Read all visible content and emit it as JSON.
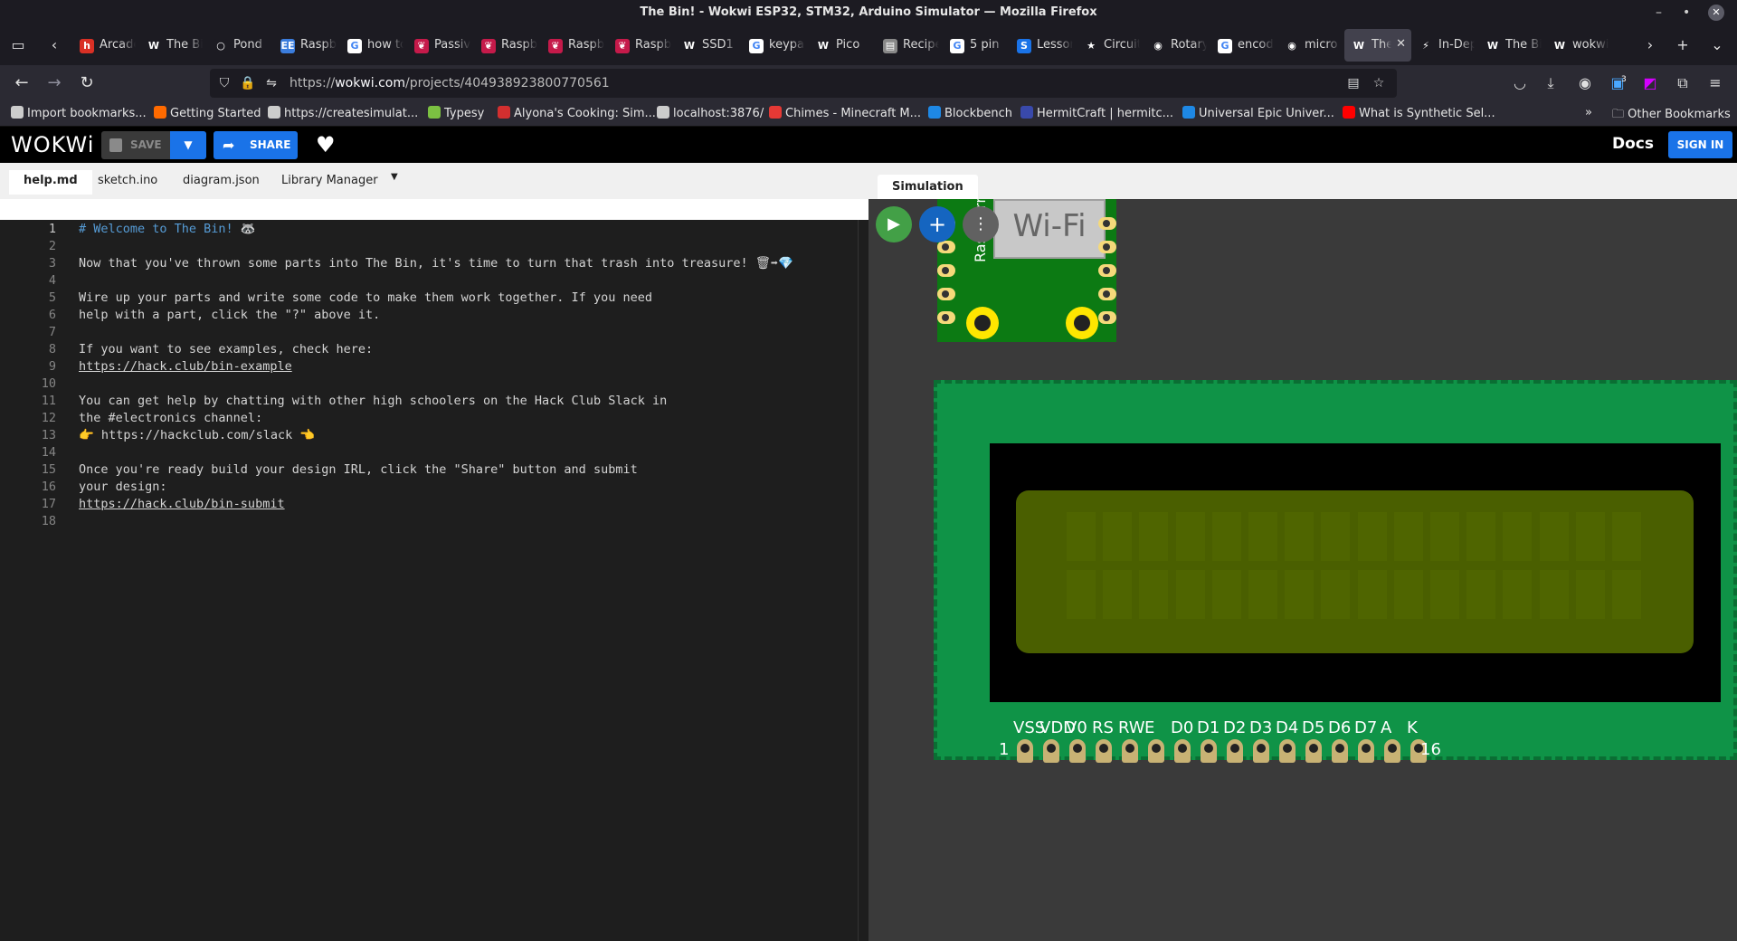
{
  "window": {
    "title": "The Bin! - Wokwi ESP32, STM32, Arduino Simulator — Mozilla Firefox",
    "controls": [
      "–",
      "•",
      "✕"
    ]
  },
  "browser": {
    "tabs": [
      {
        "label": "Arcade",
        "icon_color": "#d93025",
        "icon_char": "h"
      },
      {
        "label": "The Bin",
        "icon_color": "#1c1b22",
        "icon_char": "W"
      },
      {
        "label": "Pond",
        "icon_color": "#1c1b22",
        "icon_char": "○"
      },
      {
        "label": "Raspberry",
        "icon_color": "#3b7ddd",
        "icon_char": "EE"
      },
      {
        "label": "how to",
        "icon_color": "#ffffff",
        "icon_char": "G"
      },
      {
        "label": "Passive",
        "icon_color": "#c51a4a",
        "icon_char": "❦"
      },
      {
        "label": "Raspberry",
        "icon_color": "#c51a4a",
        "icon_char": "❦"
      },
      {
        "label": "Raspberry",
        "icon_color": "#c51a4a",
        "icon_char": "❦"
      },
      {
        "label": "Raspberry",
        "icon_color": "#c51a4a",
        "icon_char": "❦"
      },
      {
        "label": "SSD1",
        "icon_color": "#1c1b22",
        "icon_char": "W"
      },
      {
        "label": "keypad",
        "icon_color": "#ffffff",
        "icon_char": "G"
      },
      {
        "label": "Pico",
        "icon_color": "#1c1b22",
        "icon_char": "W"
      },
      {
        "label": "Recipe",
        "icon_color": "#888888",
        "icon_char": "▤"
      },
      {
        "label": "5 pin",
        "icon_color": "#ffffff",
        "icon_char": "G"
      },
      {
        "label": "Lesson",
        "icon_color": "#1a73e8",
        "icon_char": "S"
      },
      {
        "label": "Circuit",
        "icon_color": "#1c1b22",
        "icon_char": "★"
      },
      {
        "label": "Rotary",
        "icon_color": "#1c1b22",
        "icon_char": "◉"
      },
      {
        "label": "encoder",
        "icon_color": "#ffffff",
        "icon_char": "G"
      },
      {
        "label": "micro",
        "icon_color": "#1c1b22",
        "icon_char": "◉"
      },
      {
        "label": "The Bin",
        "icon_color": "#42414d",
        "icon_char": "W",
        "active": true
      },
      {
        "label": "In-Depth",
        "icon_color": "#1c1b22",
        "icon_char": "⚡"
      },
      {
        "label": "The Bin",
        "icon_color": "#1c1b22",
        "icon_char": "W"
      },
      {
        "label": "wokwi",
        "icon_color": "#1c1b22",
        "icon_char": "W"
      }
    ],
    "url_prefix": "https://",
    "url_host": "wokwi.com",
    "url_path": "/projects/404938923800770561",
    "extension_badge": "3",
    "bookmarks": [
      {
        "label": "Import bookmarks...",
        "icon_color": "#cccccc"
      },
      {
        "label": "Getting Started",
        "icon_color": "#ff6a00"
      },
      {
        "label": "https://createsimulat...",
        "icon_color": "#cccccc"
      },
      {
        "label": "Typesy",
        "icon_color": "#7cc142"
      },
      {
        "label": "Alyona's Cooking: Sim...",
        "icon_color": "#d32f2f"
      },
      {
        "label": "localhost:3876/",
        "icon_color": "#cccccc"
      },
      {
        "label": "Chimes - Minecraft M...",
        "icon_color": "#e53935"
      },
      {
        "label": "Blockbench",
        "icon_color": "#1e88e5"
      },
      {
        "label": "HermitCraft | hermitc...",
        "icon_color": "#3949ab"
      },
      {
        "label": "Universal Epic Univer...",
        "icon_color": "#1e88e5"
      },
      {
        "label": "What is Synthetic Sel...",
        "icon_color": "#ff0000"
      }
    ],
    "other_bookmarks": "Other Bookmarks"
  },
  "wokwi": {
    "logo": "WOKWi",
    "save_label": "SAVE",
    "share_label": "SHARE",
    "docs_label": "Docs",
    "signin_label": "SIGN IN"
  },
  "editor": {
    "tabs": [
      "help.md",
      "sketch.ino",
      "diagram.json",
      "Library Manager"
    ],
    "active_tab": "help.md",
    "lines": [
      "# Welcome to The Bin! 🦝",
      "",
      "Now that you've thrown some parts into The Bin, it's time to turn that trash into treasure! 🗑➡💎",
      "",
      "Wire up your parts and write some code to make them work together. If you need",
      "help with a part, click the \"?\" above it.",
      "",
      "If you want to see examples, check here:",
      "https://hack.club/bin-example",
      "",
      "You can get help by chatting with other high schoolers on the Hack Club Slack in",
      "the #electronics channel:",
      "👉 https://hackclub.com/slack 👈",
      "",
      "Once you're ready build your design IRL, click the \"Share\" button and submit",
      "your design:",
      "https://hack.club/bin-submit",
      ""
    ]
  },
  "simulation": {
    "tab_label": "Simulation",
    "pico_wifi_label": "Wi-Fi",
    "pico_board_label": "Raspberry Pi",
    "lcd_pin_labels": [
      "VSS",
      "VDD",
      "V0",
      "RS",
      "RW",
      "E",
      "D0",
      "D1",
      "D2",
      "D3",
      "D4",
      "D5",
      "D6",
      "D7",
      "A",
      "K"
    ],
    "lcd_first_pin": "1",
    "lcd_last_pin": "16",
    "colors": {
      "play": "#43a047",
      "add": "#1565c0",
      "more": "#616161"
    }
  }
}
